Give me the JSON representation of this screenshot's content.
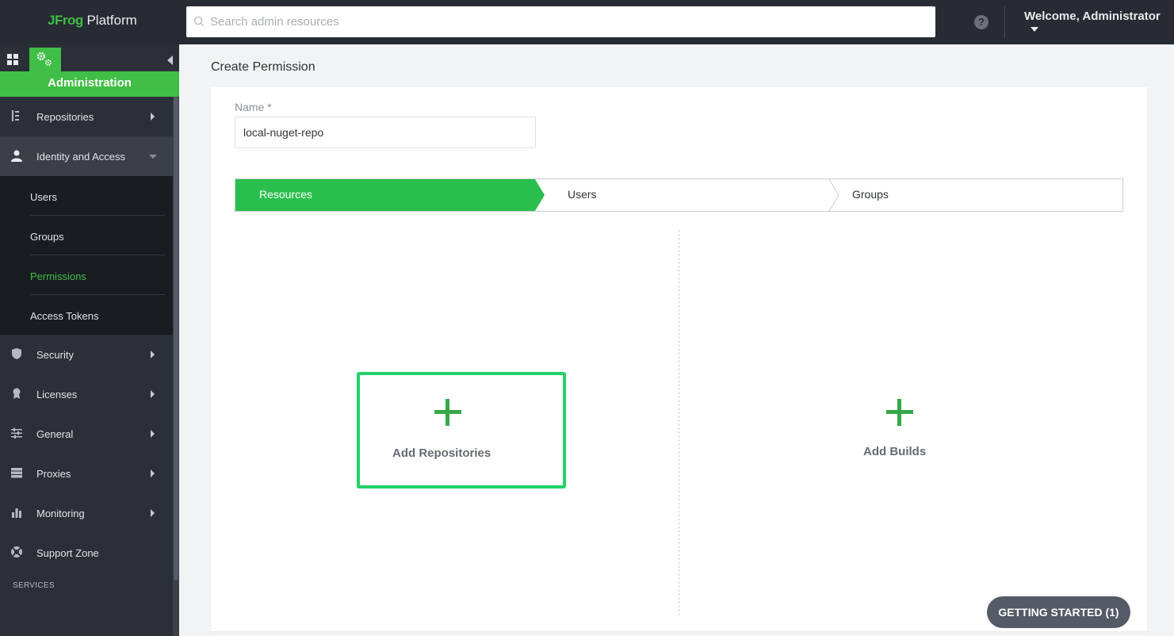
{
  "app": {
    "logo_brand": "JFrog",
    "logo_product": "Platform"
  },
  "search": {
    "placeholder": "Search admin resources",
    "value": ""
  },
  "header": {
    "help_glyph": "?",
    "welcome": "Welcome, Administrator"
  },
  "sidebar": {
    "module": "Administration",
    "items": [
      {
        "label": "Repositories",
        "icon": "tree-icon"
      },
      {
        "label": "Identity and Access",
        "icon": "user-icon",
        "expanded": true
      },
      {
        "label": "Security",
        "icon": "shield-icon"
      },
      {
        "label": "Licenses",
        "icon": "license-icon"
      },
      {
        "label": "General",
        "icon": "sliders-icon"
      },
      {
        "label": "Proxies",
        "icon": "server-icon"
      },
      {
        "label": "Monitoring",
        "icon": "bar-chart-icon"
      },
      {
        "label": "Support Zone",
        "icon": "lifebuoy-icon"
      }
    ],
    "sub_items": [
      {
        "label": "Users"
      },
      {
        "label": "Groups"
      },
      {
        "label": "Permissions",
        "current": true
      },
      {
        "label": "Access Tokens"
      }
    ],
    "services_heading": "SERVICES"
  },
  "main": {
    "page_title": "Create Permission",
    "name_label": "Name *",
    "name_value": "local-nuget-repo",
    "steps": [
      {
        "label": "Resources",
        "active": true
      },
      {
        "label": "Users"
      },
      {
        "label": "Groups"
      }
    ],
    "add_repositories_label": "Add Repositories",
    "add_builds_label": "Add Builds"
  },
  "getting_started": {
    "label": "GETTING STARTED (1)"
  },
  "colors": {
    "accent": "#40be46",
    "topbar": "#272b33",
    "sidebar": "#2b2f37",
    "submenu": "#191c21"
  }
}
